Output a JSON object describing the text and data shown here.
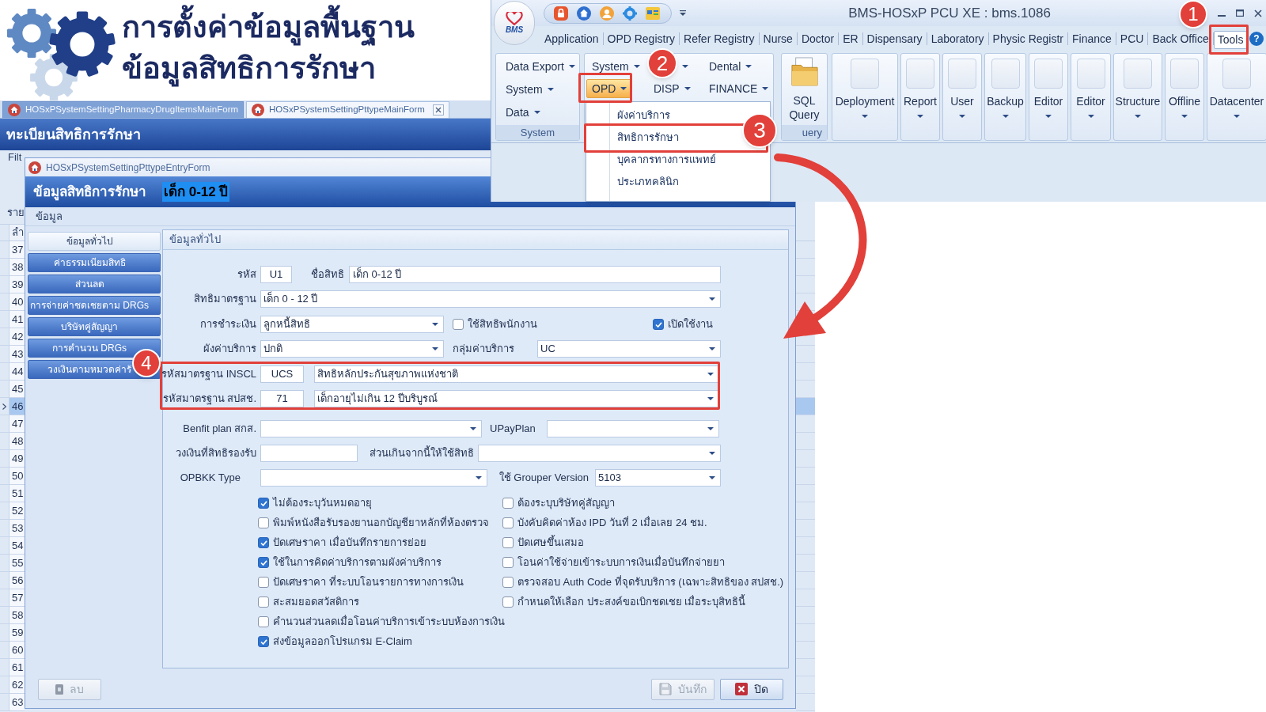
{
  "banner": {
    "lines": [
      "การตั้งค่าข้อมูลพื้นฐาน",
      "ข้อมูลสิทธิการรักษา"
    ]
  },
  "document_tabs": [
    {
      "label": "HOSxPSystemSettingPharmacyDrugItemsMainForm",
      "selected": false
    },
    {
      "label": "HOSxPSystemSettingPttypeMainForm",
      "selected": true
    }
  ],
  "main_form": {
    "title": "ทะเบียนสิทธิการรักษา",
    "filter_label": "Filt",
    "caption": "ราย",
    "column_1": "ลำ",
    "rows": [
      {
        "number": "37",
        "selected": false
      },
      {
        "number": "38",
        "selected": false
      },
      {
        "number": "39",
        "selected": false
      },
      {
        "number": "40",
        "selected": false
      },
      {
        "number": "41",
        "selected": false
      },
      {
        "number": "42",
        "selected": false
      },
      {
        "number": "43",
        "selected": false
      },
      {
        "number": "44",
        "selected": false
      },
      {
        "number": "45",
        "selected": false
      },
      {
        "number": "46",
        "selected": true
      },
      {
        "number": "47",
        "selected": false
      },
      {
        "number": "48",
        "selected": false
      },
      {
        "number": "49",
        "selected": false
      },
      {
        "number": "50",
        "selected": false
      },
      {
        "number": "51",
        "selected": false
      },
      {
        "number": "52",
        "selected": false
      },
      {
        "number": "53",
        "selected": false
      },
      {
        "number": "54",
        "selected": false
      },
      {
        "number": "55",
        "selected": false
      },
      {
        "number": "56",
        "selected": false
      },
      {
        "number": "57",
        "selected": false
      },
      {
        "number": "58",
        "selected": false
      },
      {
        "number": "59",
        "selected": false
      },
      {
        "number": "60",
        "selected": false
      },
      {
        "number": "61",
        "selected": false
      },
      {
        "number": "62",
        "selected": false
      },
      {
        "number": "63",
        "selected": false
      }
    ]
  },
  "dialog": {
    "title": "HOSxPSystemSettingPttypeEntryForm",
    "heading": "ข้อมูลสิทธิการรักษา",
    "record_name": "เด็ก 0-12 ปี",
    "section_label": "ข้อมูล",
    "nav": [
      {
        "label": "ข้อมูลทั่วไป",
        "selected": true
      },
      {
        "label": "ค่าธรรมเนียมสิทธิ",
        "selected": false
      },
      {
        "label": "ส่วนลด",
        "selected": false
      },
      {
        "label": "การจ่ายค่าชดเชยตาม DRGs",
        "selected": false
      },
      {
        "label": "บริษัทคู่สัญญา",
        "selected": false
      },
      {
        "label": "การคำนวน DRGs",
        "selected": false
      },
      {
        "label": "วงเงินตามหมวดค่ารั",
        "selected": false
      }
    ],
    "panel_title": "ข้อมูลทั่วไป",
    "fields": {
      "code": {
        "label": "รหัส",
        "value": "U1"
      },
      "name": {
        "label": "ชื่อสิทธิ",
        "value": "เด็ก 0-12 ปี"
      },
      "standard_right": {
        "label": "สิทธิมาตรฐาน",
        "value": "เด็ก 0 - 12 ปี"
      },
      "payment": {
        "label": "การชำระเงิน",
        "value": "ลูกหนี้สิทธิ"
      },
      "employee_right": {
        "label": "ใช้สิทธิพนักงาน",
        "checked": false
      },
      "active": {
        "label": "เปิดใช้งาน",
        "checked": true
      },
      "price_list": {
        "label": "ผังค่าบริการ",
        "value": "ปกติ"
      },
      "price_group": {
        "label": "กลุ่มค่าบริการ",
        "value": "UC"
      },
      "inscl": {
        "label": "รหัสมาตรฐาน INSCL",
        "code": "UCS",
        "name": "สิทธิหลักประกันสุขภาพแห่งชาติ"
      },
      "nhso": {
        "label": "รหัสมาตรฐาน สปสช.",
        "code": "71",
        "name": "เด็กอายุไม่เกิน 12 ปีบริบูรณ์"
      },
      "benefit_plan": {
        "label": "Benfit plan สกส."
      },
      "upay_plan": {
        "label": "UPayPlan"
      },
      "limit_amount": {
        "label": "วงเงินที่สิทธิรองรับ"
      },
      "excess_right": {
        "label": "ส่วนเกินจากนี้ให้ใช้สิทธิ"
      },
      "opbkk_type": {
        "label": "OPBKK Type"
      },
      "grouper_version": {
        "label": "ใช้ Grouper Version",
        "value": "5103"
      }
    },
    "checkboxes_left": [
      {
        "label": "ไม่ต้องระบุวันหมดอายุ",
        "checked": true
      },
      {
        "label": "พิมพ์หนังสือรับรองยานอกบัญชียาหลักที่ห้องตรวจ",
        "checked": false
      },
      {
        "label": "ปัดเศษราคา เมื่อบันทึกรายการย่อย",
        "checked": true
      },
      {
        "label": "ใช้ในการคิดค่าบริการตามผังค่าบริการ",
        "checked": true
      },
      {
        "label": "ปัดเศษราคา ที่ระบบโอนรายการทางการเงิน",
        "checked": false
      },
      {
        "label": "สะสมยอดสวัสดิการ",
        "checked": false
      },
      {
        "label": "คำนวนส่วนลดเมื่อโอนค่าบริการเข้าระบบห้องการเงิน",
        "checked": false
      },
      {
        "label": "ส่งข้อมูลออกโปรแกรม E-Claim",
        "checked": true
      }
    ],
    "checkboxes_right": [
      {
        "label": "ต้องระบุบริษัทคู่สัญญา",
        "checked": false
      },
      {
        "label": "บังคับคิดค่าห้อง IPD วันที่ 2 เมื่อเลย 24 ชม.",
        "checked": false
      },
      {
        "label": "ปัดเศษขึ้นเสมอ",
        "checked": false
      },
      {
        "label": "โอนค่าใช้จ่ายเข้าระบบการเงินเมื่อบันทึกจ่ายยา",
        "checked": false
      },
      {
        "label": "ตรวจสอบ Auth Code ที่จุดรับบริการ (เฉพาะสิทธิของ สปสช.)",
        "checked": false
      },
      {
        "label": "กำหนดให้เลือก ประสงค์ขอเบิกชดเชย เมื่อระบุสิทธินี้",
        "checked": false
      }
    ],
    "buttons": [
      {
        "label": "ลบ",
        "kind": "delete",
        "disabled": true
      },
      {
        "label": "บันทึก",
        "kind": "save",
        "disabled": true
      },
      {
        "label": "ปิด",
        "kind": "close",
        "disabled": false
      }
    ]
  },
  "ribbon_window": {
    "logo_text": "BMS",
    "title": "BMS-HOSxP PCU XE : bms.1086",
    "tabs": [
      {
        "label": "Application",
        "selected": false
      },
      {
        "label": "OPD Registry",
        "selected": false
      },
      {
        "label": "Refer Registry",
        "selected": false
      },
      {
        "label": "Nurse",
        "selected": false
      },
      {
        "label": "Doctor",
        "selected": false
      },
      {
        "label": "ER",
        "selected": false
      },
      {
        "label": "Dispensary",
        "selected": false
      },
      {
        "label": "Laboratory",
        "selected": false
      },
      {
        "label": "Physic Registr",
        "selected": false
      },
      {
        "label": "Finance",
        "selected": false
      },
      {
        "label": "PCU",
        "selected": false
      },
      {
        "label": "Back Office",
        "selected": false
      },
      {
        "label": "Tools",
        "selected": true
      }
    ],
    "help": "?",
    "system_group": {
      "label": "System",
      "items": [
        "Data Export",
        "System",
        "Data"
      ]
    },
    "module_rows": [
      [
        {
          "label": "System",
          "selected": false
        },
        {
          "label": "Dental",
          "selected": false
        }
      ],
      [
        {
          "label": "OPD",
          "selected": true
        },
        {
          "label": "DISP",
          "selected": false
        },
        {
          "label": "FINANCE",
          "selected": false
        }
      ]
    ],
    "query_group": {
      "button": "SQL Query",
      "label": "uery"
    },
    "large_buttons": [
      "Deployment",
      "Report",
      "User",
      "Backup",
      "Editor",
      "Editor",
      "Structure",
      "Offline",
      "Datacenter"
    ],
    "menu": [
      "ผังค่าบริการ",
      "สิทธิการรักษา",
      "บุคลากรทางการแพทย์",
      "ประเภทคลินิก"
    ]
  },
  "annotations": {
    "markers": [
      "1",
      "2",
      "3",
      "4"
    ]
  }
}
